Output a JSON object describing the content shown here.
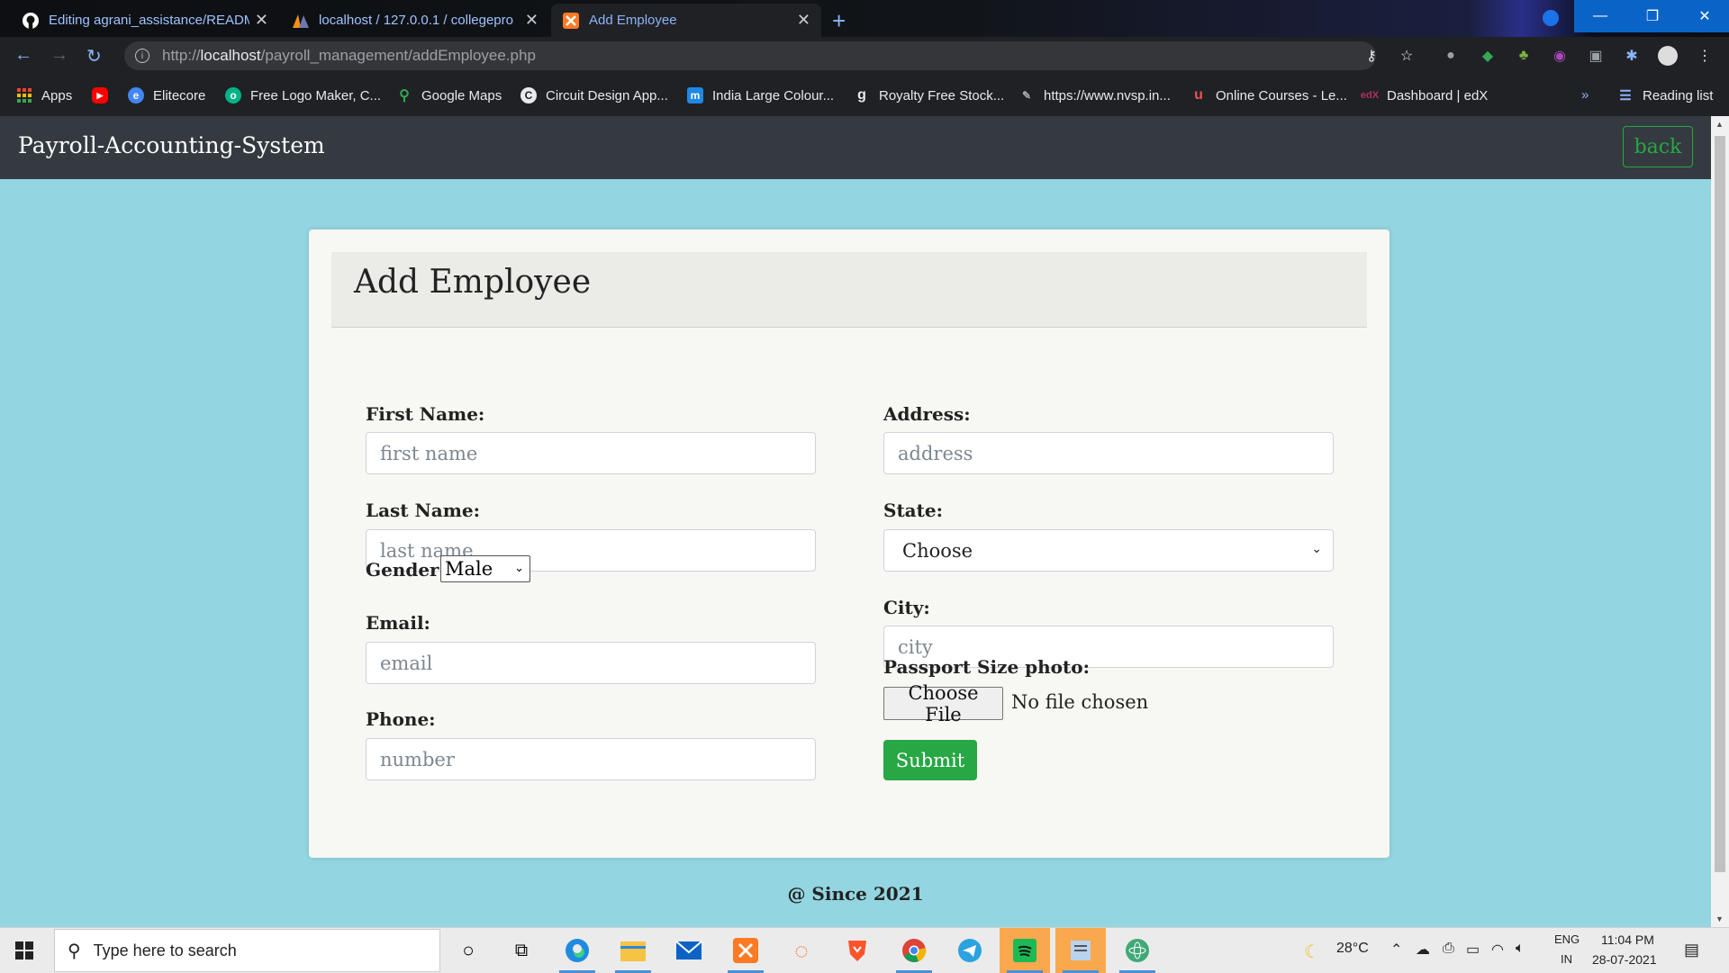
{
  "browser": {
    "tabs": [
      {
        "title": "Editing agrani_assistance/README",
        "icon": "github-icon"
      },
      {
        "title": "localhost / 127.0.0.1 / collegepro",
        "icon": "phpmyadmin-icon"
      },
      {
        "title": "Add Employee",
        "icon": "xampp-icon"
      }
    ],
    "address": {
      "scheme": "http://",
      "host": "localhost",
      "path": "/payroll_management/addEmployee.php"
    },
    "bookmarks": [
      {
        "label": "Apps",
        "icon": "apps-grid-icon",
        "color": "#ea4335"
      },
      {
        "label": "",
        "icon": "youtube-icon",
        "color": "#ff0000"
      },
      {
        "label": "Elitecore",
        "icon": "globe-icon",
        "color": "#4285f4"
      },
      {
        "label": "Free Logo Maker, C...",
        "icon": "logo-maker-icon",
        "color": "#00b388"
      },
      {
        "label": "Google Maps",
        "icon": "maps-pin-icon",
        "color": "#34a853"
      },
      {
        "label": "Circuit Design App...",
        "icon": "circuit-icon",
        "color": "#e8eaed"
      },
      {
        "label": "India Large Colour...",
        "icon": "m-icon",
        "color": "#1e88e5"
      },
      {
        "label": "Royalty Free Stock...",
        "icon": "g-icon",
        "color": "#444"
      },
      {
        "label": "https://www.nvsp.in...",
        "icon": "nvsp-icon",
        "color": "#888"
      },
      {
        "label": "Online Courses - Le...",
        "icon": "udemy-icon",
        "color": "#ec5252"
      },
      {
        "label": "Dashboard | edX",
        "icon": "edx-icon",
        "color": "#b3315f"
      }
    ],
    "reading_list": "Reading list",
    "overflow": "»"
  },
  "app": {
    "brand": "Payroll-Accounting-System",
    "back_label": "back"
  },
  "form": {
    "title": "Add Employee",
    "first_name": {
      "label": "First Name:",
      "placeholder": "first name"
    },
    "last_name": {
      "label": "Last Name:",
      "placeholder": "last name"
    },
    "gender": {
      "label": "Gender:",
      "value": "Male"
    },
    "email": {
      "label": "Email:",
      "placeholder": "email"
    },
    "phone": {
      "label": "Phone:",
      "placeholder": "number"
    },
    "address": {
      "label": "Address:",
      "placeholder": "address"
    },
    "state": {
      "label": "State:",
      "value": "Choose"
    },
    "city": {
      "label": "City:",
      "placeholder": "city"
    },
    "photo": {
      "label": "Passport Size photo:",
      "button": "Choose File",
      "status": "No file chosen"
    },
    "submit_label": "Submit"
  },
  "footer": "@ Since 2021",
  "taskbar": {
    "search_placeholder": "Type here to search",
    "weather": "28°C",
    "lang": "ENG",
    "region": "IN",
    "time": "11:04 PM",
    "date": "28-07-2021"
  },
  "colors": {
    "accent_green": "#28a745",
    "page_bg": "#93d5e0",
    "navbar": "#343a40"
  }
}
